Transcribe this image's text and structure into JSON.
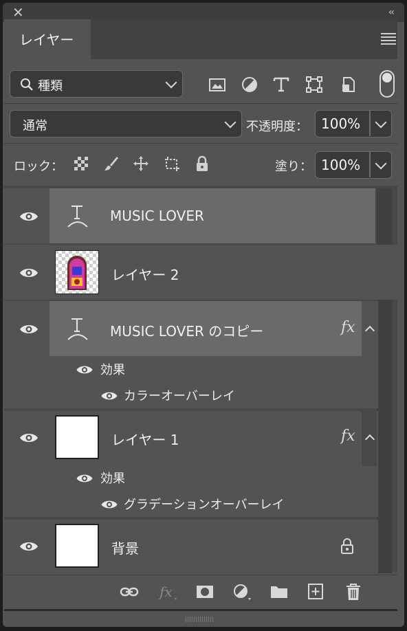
{
  "panel": {
    "tab_label": "レイヤー",
    "close_glyph": "✕",
    "collapse_glyph": "‹‹"
  },
  "filter": {
    "kind_label": "種類",
    "icons": [
      "image-filter-icon",
      "adjustment-filter-icon",
      "type-filter-icon",
      "shape-filter-icon",
      "smart-object-filter-icon"
    ]
  },
  "blend": {
    "mode": "通常",
    "opacity_label": "不透明度：",
    "opacity_value": "100%"
  },
  "lock": {
    "label": "ロック：",
    "fill_label": "塗り：",
    "fill_value": "100%"
  },
  "layers": [
    {
      "name": "MUSIC LOVER",
      "type": "text",
      "selected": true
    },
    {
      "name": "レイヤー 2",
      "type": "image",
      "selected": false
    },
    {
      "name": "MUSIC LOVER のコピー",
      "type": "text",
      "selected": true,
      "fx": "fx",
      "effects_label": "効果",
      "effects": [
        "カラーオーバーレイ"
      ]
    },
    {
      "name": "レイヤー 1",
      "type": "image",
      "selected": false,
      "fx": "fx",
      "effects_label": "効果",
      "effects": [
        "グラデーションオーバーレイ"
      ]
    },
    {
      "name": "背景",
      "type": "background",
      "locked": true
    }
  ],
  "bottom_icons": [
    "link-layers-icon",
    "fx-icon",
    "mask-icon",
    "adjustment-layer-icon",
    "group-folder-icon",
    "new-layer-icon",
    "trash-icon"
  ],
  "colors": {
    "panel_bg": "#535353",
    "selected_row": "#6a6a6a",
    "field_bg": "#393939"
  }
}
